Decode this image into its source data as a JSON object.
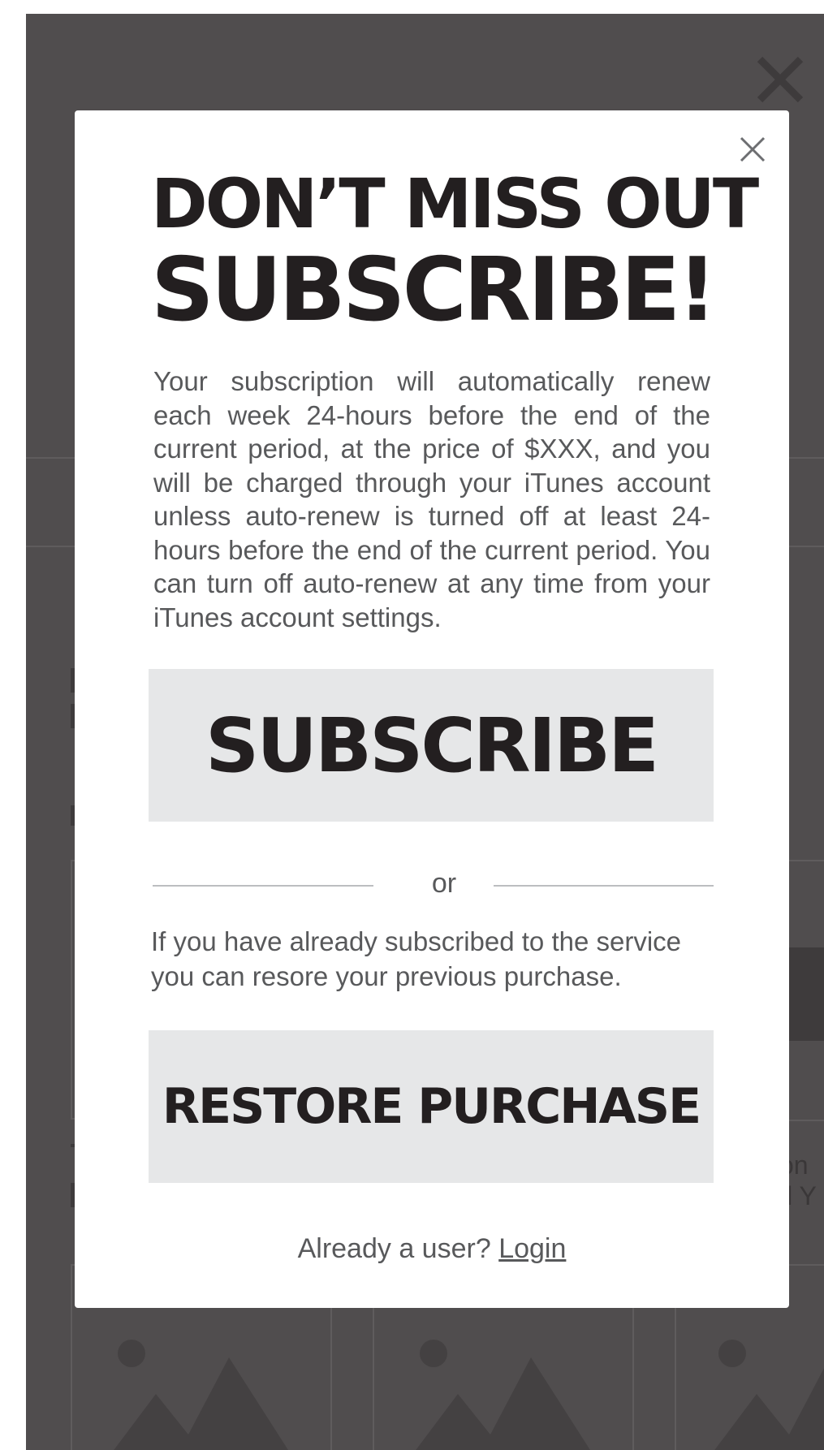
{
  "modal": {
    "headline_line1": "DON’T MISS OUT",
    "headline_line2": "SUBSCRIBE!",
    "terms": "Your subscription will automatically renew each week 24-hours before the end of the current period, at the price of $XXX, and you will be charged through your iTunes account unless auto-renew is turned off at least 24-hours before the end of the current period. You can turn off auto-renew at any time from your iTunes account settings.",
    "subscribe_label": "SUBSCRIBE",
    "divider_label": "or",
    "restore_info": "If you have already subscribed to the service you can resore your previous purchase.",
    "restore_label": "RESTORE PURCHASE",
    "footer_prompt": "Already a user?",
    "login_label": "Login",
    "close_icon": "close-icon"
  },
  "background": {
    "close_icon": "close-icon",
    "peek_text_line1": "on",
    "peek_text_line2": "ll Y"
  },
  "colors": {
    "overlay": "#504d4e",
    "modal_bg": "#ffffff",
    "button_bg": "#e6e7e8",
    "heading": "#231f20",
    "body_text": "#58595b"
  }
}
